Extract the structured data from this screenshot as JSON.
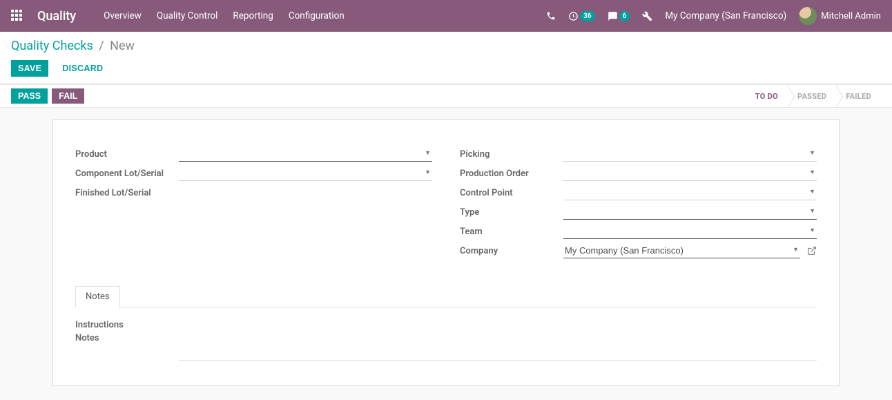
{
  "nav": {
    "brand": "Quality",
    "links": [
      "Overview",
      "Quality Control",
      "Reporting",
      "Configuration"
    ],
    "activity_count": "36",
    "msg_count": "6",
    "company": "My Company (San Francisco)",
    "user": "Mitchell Admin"
  },
  "breadcrumb": {
    "parent": "Quality Checks",
    "current": "New"
  },
  "actions": {
    "save": "SAVE",
    "discard": "DISCARD"
  },
  "status_buttons": {
    "pass": "PASS",
    "fail": "FAIL"
  },
  "stages": [
    "TO DO",
    "PASSED",
    "FAILED"
  ],
  "active_stage": 0,
  "form": {
    "left": [
      {
        "label": "Product",
        "value": "",
        "required": true,
        "dropdown": true
      },
      {
        "label": "Component Lot/Serial",
        "value": "",
        "required": false,
        "dropdown": true
      },
      {
        "label": "Finished Lot/Serial",
        "value": "",
        "required": false,
        "dropdown": false,
        "noline": true
      }
    ],
    "right": [
      {
        "label": "Picking",
        "value": "",
        "required": false,
        "dropdown": true
      },
      {
        "label": "Production Order",
        "value": "",
        "required": false,
        "dropdown": true
      },
      {
        "label": "Control Point",
        "value": "",
        "required": false,
        "dropdown": true
      },
      {
        "label": "Type",
        "value": "",
        "required": true,
        "dropdown": true
      },
      {
        "label": "Team",
        "value": "",
        "required": true,
        "dropdown": true
      },
      {
        "label": "Company",
        "value": "My Company (San Francisco)",
        "required": true,
        "dropdown": true,
        "external": true
      }
    ]
  },
  "tabs": {
    "notes": "Notes"
  },
  "notes": {
    "instructions_label": "Instructions",
    "notes_label": "Notes"
  }
}
